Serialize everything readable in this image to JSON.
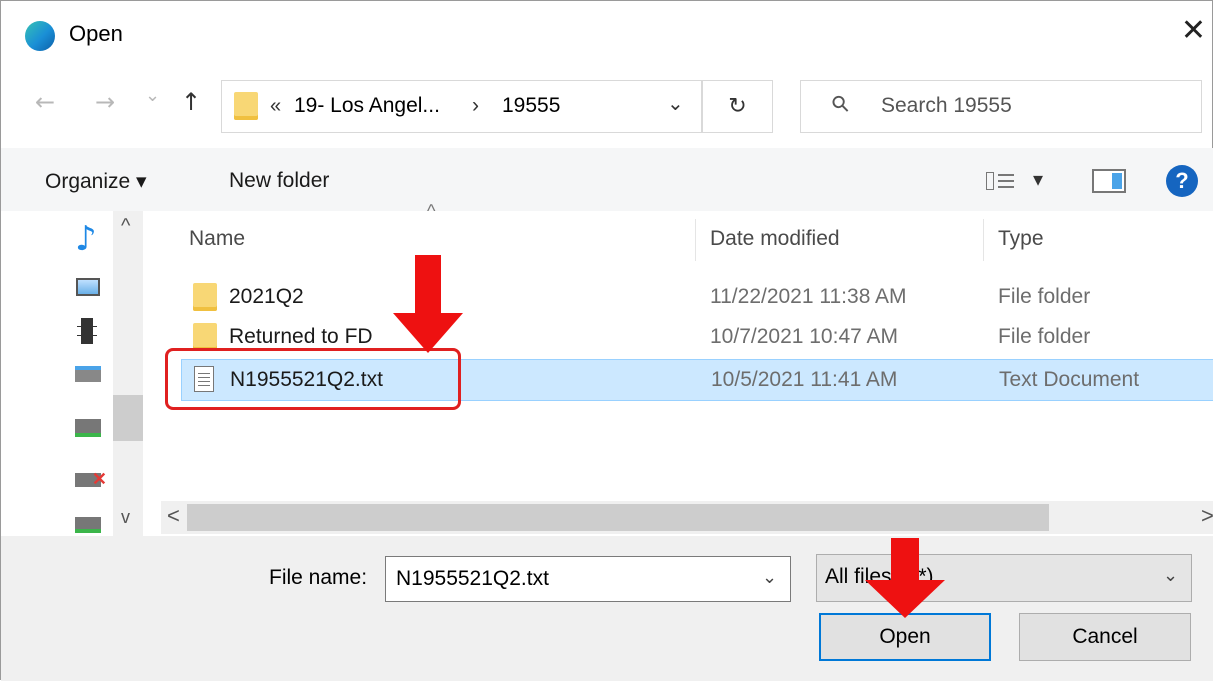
{
  "window": {
    "title": "Open",
    "close_glyph": "✕"
  },
  "nav": {
    "back": "←",
    "forward": "→",
    "recent": "⌄",
    "up": "↑"
  },
  "address": {
    "overflow_glyph": "«",
    "crumb1": "19- Los Angel...",
    "sep": "›",
    "crumb2": "19555",
    "dropdown": "⌄",
    "refresh": "↻"
  },
  "search": {
    "icon": "⚲",
    "placeholder": "Search 19555"
  },
  "toolbar": {
    "organize": "Organize ▾",
    "new_folder": "New folder",
    "view_dropdown": "▾",
    "help": "?"
  },
  "columns": {
    "name": "Name",
    "date": "Date modified",
    "type": "Type",
    "sort_glyph": "^"
  },
  "files": [
    {
      "name": "2021Q2",
      "date": "11/22/2021 11:38 AM",
      "type": "File folder",
      "kind": "folder"
    },
    {
      "name": "Returned to FD",
      "date": "10/7/2021 10:47 AM",
      "type": "File folder",
      "kind": "folder"
    },
    {
      "name": "N1955521Q2.txt",
      "date": "10/5/2021 11:41 AM",
      "type": "Text Document",
      "kind": "text",
      "selected": true
    }
  ],
  "hscroll": {
    "left": "<",
    "right": ">"
  },
  "vscroll": {
    "up": "^",
    "down": "v"
  },
  "bottom": {
    "file_name_label": "File name:",
    "file_name_value": "N1955521Q2.txt",
    "file_type_value": "All files (*.*)",
    "open": "Open",
    "cancel": "Cancel"
  },
  "colors": {
    "selection": "#cce8ff",
    "annotation_red": "#ee1111",
    "folder": "#f8d775",
    "primary_border": "#0078d7",
    "help_blue": "#1565c0"
  }
}
